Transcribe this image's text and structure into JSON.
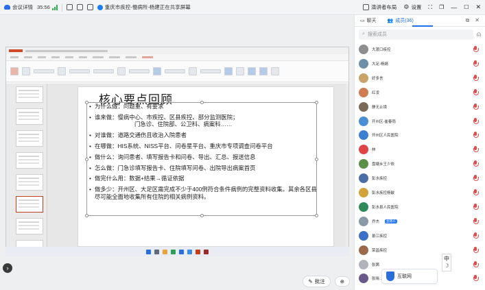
{
  "topbar": {
    "app_label": "会议详情",
    "elapsed": "35:56",
    "meeting_title": "重庆市疾控-慢病所-杨建正在共享屏幕",
    "layout_label": "演讲者布局",
    "settings_label": "设置"
  },
  "panel": {
    "tab_chat": "聊天",
    "tab_members": "成员(36)",
    "search_placeholder": "搜索成员",
    "members": [
      {
        "name": "大渡口疾控",
        "color": "#8e8e8e",
        "host": false
      },
      {
        "name": "大足-杨婧",
        "color": "#6f8fa8",
        "host": false
      },
      {
        "name": "好多言",
        "color": "#c9a46a",
        "host": false
      },
      {
        "name": "红凌",
        "color": "#d07b52",
        "host": false
      },
      {
        "name": "静无止境",
        "color": "#7a6a5a",
        "host": false
      },
      {
        "name": "开州区-崔春雨",
        "color": "#4a8fd6",
        "host": false
      },
      {
        "name": "开州区人民医院",
        "color": "#3c7ed0",
        "host": false
      },
      {
        "name": "林",
        "color": "#e04444",
        "host": false
      },
      {
        "name": "盘塘乡王少依",
        "color": "#5b8f4a",
        "host": false
      },
      {
        "name": "彭水疾控",
        "color": "#4a6fa5",
        "host": false
      },
      {
        "name": "彭水疾控杨敏",
        "color": "#d2a23c",
        "host": false
      },
      {
        "name": "彭水县人民医院",
        "color": "#2f8a5a",
        "host": false
      },
      {
        "name": "乔杰",
        "color": "#8a9aa8",
        "host": true,
        "badge": "主持人"
      },
      {
        "name": "綦江疾控",
        "color": "#3a70c8",
        "host": false
      },
      {
        "name": "荣昌疾控",
        "color": "#9a6a4a",
        "host": false
      },
      {
        "name": "张茜",
        "color": "#b0b4ba",
        "host": false
      },
      {
        "name": "张晓...",
        "color": "#6a5a8a",
        "host": false
      }
    ]
  },
  "slide": {
    "title": "核心要点回顾",
    "bullets": [
      {
        "text": "为什么做：问题重、有要求",
        "cont": ""
      },
      {
        "text": "谁来做：慢病中心、市疾控、区县疾控、部分监测医院；",
        "cont": "门急诊、住院部、公卫科、病案科……"
      },
      {
        "text": "对谁做：道路交通伤且收治入院患者",
        "cont": ""
      },
      {
        "text": "在哪做：HIS系统、NISS平台、问卷星平台、重庆市专项调查问卷平台",
        "cont": ""
      },
      {
        "text": "做什么：询问患者、填写报告卡和问卷、导出、汇总、报送信息",
        "cont": ""
      },
      {
        "text": "怎么做：门急诊填写报告卡、住院填写问卷、出院导出病案首页",
        "cont": ""
      },
      {
        "text": "做完什么用：数据+结果→循证依据",
        "cont": ""
      },
      {
        "text": "做多少：开州区、大足区需完成不少于400例符合条件病例的完整资料收集。其余各区县尽可能全面地收集所有住院的相关病例资料。",
        "cont": ""
      }
    ]
  },
  "stage": {
    "annotate_label": "批注",
    "ime_char": "中",
    "float_label": "互联网"
  }
}
